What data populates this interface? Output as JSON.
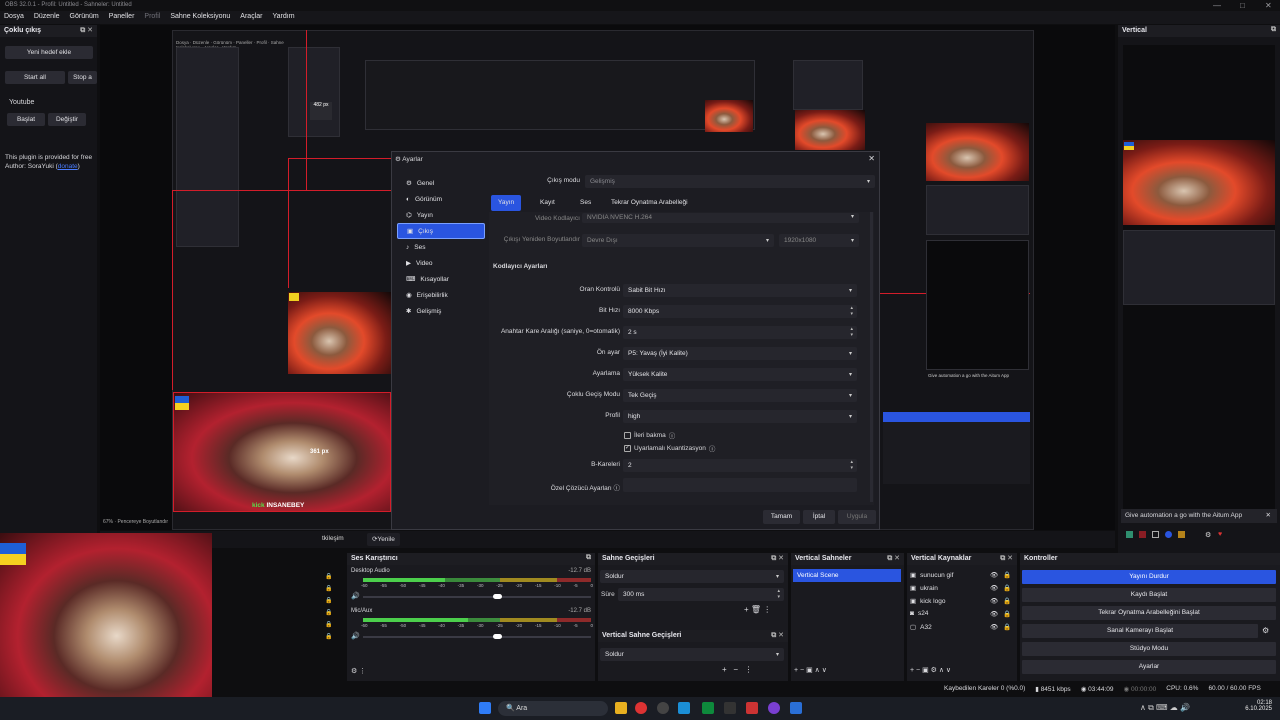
{
  "window": {
    "title": "OBS 32.0.1 - Profil: Untitled - Sahneler: Untitled"
  },
  "menu": [
    "Dosya",
    "Düzenle",
    "Görünüm",
    "Paneller",
    "Profil",
    "Sahne Koleksiyonu",
    "Araçlar",
    "Yardım"
  ],
  "multi_output": {
    "header": "Çoklu çıkış",
    "new_target": "Yeni hedef ekle",
    "start_all": "Start all",
    "stop_all": "Stop a",
    "youtube_label": "Youtube",
    "start_btn": "Başlat",
    "change_btn": "Değiştir",
    "plugin_note": "This plugin is provided for free",
    "author_prefix": "Author: SoraYuki (",
    "author_link": "donate",
    "author_suffix": ")"
  },
  "vertical_panel": {
    "header": "Vertical",
    "banner": "Give automation a go with the Aitum App"
  },
  "overlay_texts": {
    "px_482": "482 px",
    "px_361": "361 px",
    "kick_user": "INSANEBEY",
    "kick_brand": "kick",
    "zoom": "67%",
    "fit": "Pencereye Boyutlandır"
  },
  "settings": {
    "title": "Ayarlar",
    "nav": [
      {
        "label": "Genel",
        "icon": "gear-icon"
      },
      {
        "label": "Görünüm",
        "icon": "appearance-icon"
      },
      {
        "label": "Yayın",
        "icon": "broadcast-icon"
      },
      {
        "label": "Çıkış",
        "icon": "output-icon"
      },
      {
        "label": "Ses",
        "icon": "audio-icon"
      },
      {
        "label": "Video",
        "icon": "video-icon"
      },
      {
        "label": "Kısayollar",
        "icon": "keyboard-icon"
      },
      {
        "label": "Erişebilirlik",
        "icon": "accessibility-icon"
      },
      {
        "label": "Gelişmiş",
        "icon": "advanced-icon"
      }
    ],
    "output_mode_label": "Çıkış modu",
    "output_mode_value": "Gelişmiş",
    "tabs": [
      "Yayın",
      "Kayıt",
      "Ses",
      "Tekrar Oynatma Arabelleği"
    ],
    "video_encoder_label": "Video Kodlayıcı",
    "video_encoder_value": "NVIDIA NVENC H.264",
    "rescale_label": "Çıkışı Yeniden Boyutlandır",
    "rescale_value": "Devre Dışı",
    "rescale_res": "1920x1080",
    "encoder_section": "Kodlayıcı Ayarları",
    "rate_control_label": "Oran Kontrolü",
    "rate_control_value": "Sabit Bit Hızı",
    "bitrate_label": "Bit Hızı",
    "bitrate_value": "8000 Kbps",
    "keyframe_label": "Anahtar Kare Aralığı (saniye, 0=otomatik)",
    "keyframe_value": "2 s",
    "preset_label": "Ön ayar",
    "preset_value": "P5: Yavaş (İyi Kalite)",
    "tuning_label": "Ayarlama",
    "tuning_value": "Yüksek Kalite",
    "multipass_label": "Çoklu Geçiş Modu",
    "multipass_value": "Tek Geçiş",
    "profile_label": "Profil",
    "profile_value": "high",
    "lookahead_label": "İleri bakma",
    "aq_label": "Uyarlamalı Kuantizasyon",
    "bframes_label": "B-Kareleri",
    "bframes_value": "2",
    "custom_opts_label": "Özel Çözücü Ayarları",
    "ok": "Tamam",
    "cancel": "İptal",
    "apply": "Uygula"
  },
  "docks": {
    "stream_label": "Yayın",
    "refresh": "Yenile",
    "partial_tab": "tkileşim",
    "audio_mixer": {
      "header": "Ses Karıştırıcı",
      "channels": [
        {
          "name": "Desktop Audio",
          "db": "-12.7 dB",
          "level": 0.36
        },
        {
          "name": "Mic/Aux",
          "db": "-12.7 dB",
          "level": 0.46
        }
      ],
      "ticks": [
        "-60",
        "-55",
        "-50",
        "-45",
        "-40",
        "-35",
        "-30",
        "-25",
        "-20",
        "-15",
        "-10",
        "-5",
        "0"
      ]
    },
    "transitions": {
      "header": "Sahne Geçişleri",
      "type": "Soldur",
      "duration_label": "Süre",
      "duration_value": "300 ms"
    },
    "vertical_transitions": {
      "header": "Vertical Sahne Geçişleri",
      "type": "Soldur"
    },
    "vertical_scenes": {
      "header": "Vertical Sahneler",
      "items": [
        "Vertical Scene"
      ]
    },
    "vertical_sources": {
      "header": "Vertical Kaynaklar",
      "items": [
        "sunucun gif",
        "ukrain",
        "kick logo",
        "s24",
        "A32"
      ]
    },
    "controls": {
      "header": "Kontroller",
      "buttons": [
        "Yayını Durdur",
        "Kaydı Başlat",
        "Tekrar Oynatma Arabelleğini Başlat",
        "Sanal Kamerayı Başlat",
        "Stüdyo Modu",
        "Ayarlar"
      ]
    }
  },
  "status": {
    "dropped": "Kaybedilen Kareler 0 (%0.0)",
    "bitrate": "8451 kbps",
    "stream_time": "03:44:09",
    "rec_time": "00:00:00",
    "cpu": "CPU: 0.6%",
    "fps": "60.00 / 60.00 FPS"
  },
  "taskbar": {
    "search": "Ara",
    "time": "02:18",
    "date": "6.10.2025"
  },
  "colors": {
    "accent": "#2a55e0",
    "red_guide": "#d31d2a",
    "bg": "#0e0e10"
  }
}
